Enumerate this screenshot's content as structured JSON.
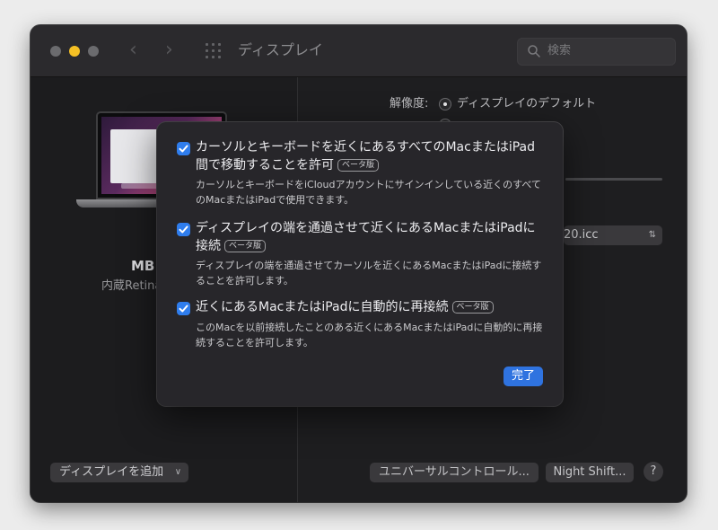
{
  "window": {
    "title": "ディスプレイ",
    "search_placeholder": "検索"
  },
  "display": {
    "name": "MB1",
    "subtitle": "内蔵Retina"
  },
  "resolution": {
    "label": "解像度:",
    "options": [
      {
        "label": "ディスプレイのデフォルト",
        "selected": true
      },
      {
        "label": "",
        "selected": false
      }
    ]
  },
  "color_profile": {
    "value": "20.icc"
  },
  "bottom_bar": {
    "add_display": "ディスプレイを追加",
    "universal_control": "ユニバーサルコントロール...",
    "night_shift": "Night Shift...",
    "help": "?"
  },
  "sheet": {
    "beta_label": "ベータ版",
    "options": [
      {
        "checked": true,
        "title": "カーソルとキーボードを近くにあるすべてのMacまたはiPad間で移動することを許可",
        "description": "カーソルとキーボードをiCloudアカウントにサインインしている近くのすべてのMacまたはiPadで使用できます。"
      },
      {
        "checked": true,
        "title": "ディスプレイの端を通過させて近くにあるMacまたはiPadに接続",
        "description": "ディスプレイの端を通過させてカーソルを近くにあるMacまたはiPadに接続することを許可します。"
      },
      {
        "checked": true,
        "title": "近くにあるMacまたはiPadに自動的に再接続",
        "description": "このMacを以前接続したことのある近くにあるMacまたはiPadに自動的に再接続することを許可します。"
      }
    ],
    "done_label": "完了"
  },
  "colors": {
    "accent": "#2f7ded",
    "window_bg": "#1d1d1f",
    "sheet_bg": "#27262a",
    "minimize_light": "#f5c025"
  }
}
